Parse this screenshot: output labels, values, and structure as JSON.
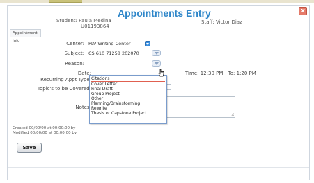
{
  "window": {
    "title": "Appointments Entry",
    "close_label": "x"
  },
  "header": {
    "student_label": "Student:",
    "student_name": "Paula Medina",
    "student_id": "U01193864",
    "staff_label": "Staff:",
    "staff_name": "Victor Diaz"
  },
  "tabs": [
    {
      "label": "Appointment Info"
    }
  ],
  "form": {
    "center_label": "Center:",
    "center_value": "PLV Writing Center",
    "subject_label": "Subject:",
    "subject_value": "CS 610 71258 202070",
    "reason_label": "Reason:",
    "date_label": "Date:",
    "recurring_label": "Recurring Appt Type:",
    "topics_label": "Topic's to be Covered:",
    "notes_label": "Notes:",
    "time_label": "Time:",
    "time_value": "12:30 PM",
    "to_label": "To:",
    "to_value": "1:20 PM"
  },
  "reason_options": [
    "Citations",
    "Cover Letter",
    "Final Draft",
    "Group Project",
    "Other",
    "Planning/Brainstorming",
    "Rewrite",
    "Thesis or Capstone Project"
  ],
  "meta": {
    "created": "Created 00/00/00 at 00:00:00 by",
    "modified": "Modified 00/00/00 at 00:00:00 by"
  },
  "actions": {
    "save_label": "Save"
  },
  "colors": {
    "title": "#2e86c9",
    "close": "#e57b6a",
    "select_accent": "#3b8fe0"
  }
}
